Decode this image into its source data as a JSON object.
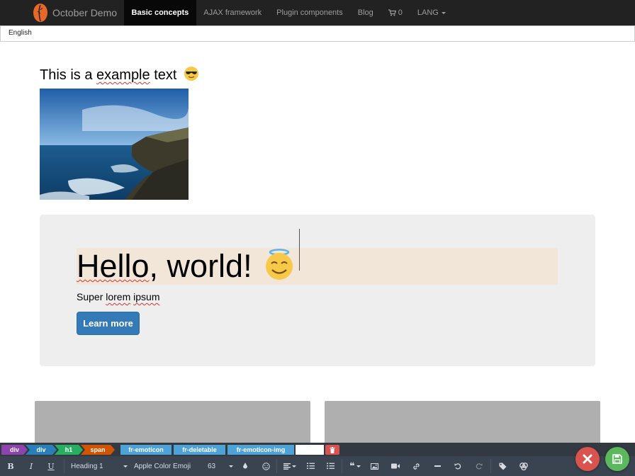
{
  "nav": {
    "brand": "October Demo",
    "items": [
      {
        "label": "Basic concepts",
        "active": true
      },
      {
        "label": "AJAX framework",
        "active": false
      },
      {
        "label": "Plugin components",
        "active": false
      },
      {
        "label": "Blog",
        "active": false
      }
    ],
    "cart_count": "0",
    "lang_label": "LANG"
  },
  "lang_bar": {
    "selected": "English"
  },
  "content": {
    "title_pre": "This is a ",
    "title_word": "example",
    "title_post": " text",
    "title_emoji": "sunglasses-emoji",
    "hero": {
      "heading_word": "Hello",
      "heading_rest": ", world!",
      "heading_emoji": "angel-emoji",
      "sub_pre": "Super ",
      "sub_word1": "lorem",
      "sub_word2": "ipsum",
      "button_label": "Learn more"
    }
  },
  "editor": {
    "breadcrumbs": [
      {
        "label": "div",
        "color": "#8e44ad"
      },
      {
        "label": "div",
        "color": "#2980b9"
      },
      {
        "label": "h1",
        "color": "#27ae60"
      },
      {
        "label": "span",
        "color": "#d35400"
      }
    ],
    "classes": [
      "fr-emoticon",
      "fr-deletable",
      "fr-emoticon-img"
    ],
    "toolbar": {
      "bold": "B",
      "italic": "I",
      "underline": "U",
      "paragraph_format": "Heading 1",
      "font_family": "Apple Color Emoji",
      "font_size": "63"
    }
  },
  "colors": {
    "navbar_bg": "#222222",
    "primary_button": "#337ab7",
    "cancel_fab": "#d9534f",
    "save_fab": "#5cb85c"
  }
}
